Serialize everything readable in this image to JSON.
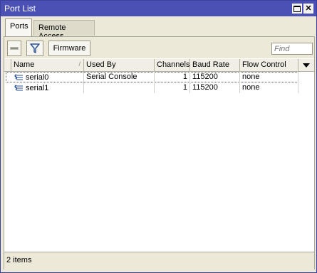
{
  "window": {
    "title": "Port List"
  },
  "tabs": [
    {
      "label": "Ports",
      "active": true
    },
    {
      "label": "Remote Access",
      "active": false
    }
  ],
  "toolbar": {
    "remove_icon": "minus-icon",
    "filter_icon": "filter-icon",
    "firmware_label": "Firmware",
    "find_placeholder": "Find"
  },
  "table": {
    "columns": [
      "Name",
      "Used By",
      "Channels",
      "Baud Rate",
      "Flow Control"
    ],
    "rows": [
      {
        "name": "serial0",
        "used_by": "Serial Console",
        "channels": "1",
        "baud_rate": "115200",
        "flow_control": "none"
      },
      {
        "name": "serial1",
        "used_by": "",
        "channels": "1",
        "baud_rate": "115200",
        "flow_control": "none"
      }
    ]
  },
  "status": {
    "items": "2 items"
  },
  "colors": {
    "titlebar": "#4b50b4",
    "chrome": "#ece9d8",
    "accent_icon": "#2a4f8f"
  }
}
